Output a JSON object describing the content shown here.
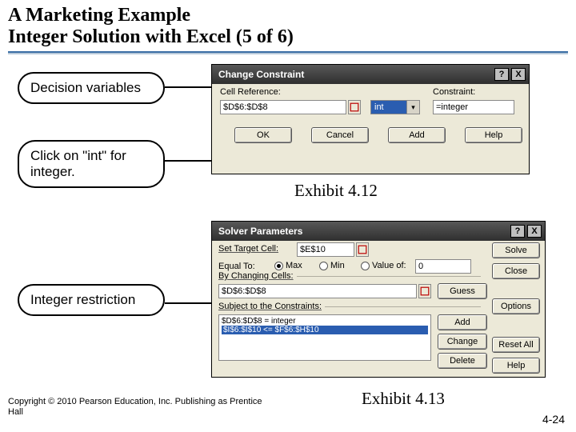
{
  "title": {
    "line1": "A Marketing Example",
    "line2": "Integer Solution with Excel (5 of 6)"
  },
  "bubbles": {
    "decision_vars": "Decision variables",
    "click_int": "Click on \"int\" for integer.",
    "int_restriction": "Integer restriction"
  },
  "dialog1": {
    "title": "Change Constraint",
    "cell_ref_label": "Cell Reference:",
    "cell_ref_value": "$D$6:$D$8",
    "op_value": "int",
    "constraint_label": "Constraint:",
    "constraint_value": "=integer",
    "buttons": {
      "ok": "OK",
      "cancel": "Cancel",
      "add": "Add",
      "help": "Help"
    }
  },
  "dialog2": {
    "title": "Solver Parameters",
    "set_target_label": "Set Target Cell:",
    "set_target_value": "$E$10",
    "equal_to_label": "Equal To:",
    "radios": {
      "max": "Max",
      "min": "Min",
      "value_of": "Value of:"
    },
    "value_of_value": "0",
    "by_changing_label": "By Changing Cells:",
    "by_changing_value": "$D$6:$D$8",
    "subject_label": "Subject to the Constraints:",
    "constraints": [
      "$D$6:$D$8 = integer",
      "$I$6:$I$10 <= $F$6:$H$10"
    ],
    "buttons": {
      "solve": "Solve",
      "close": "Close",
      "guess": "Guess",
      "options": "Options",
      "add": "Add",
      "change": "Change",
      "delete": "Delete",
      "reset": "Reset All",
      "help": "Help"
    }
  },
  "exhibits": {
    "e412": "Exhibit 4.12",
    "e413": "Exhibit 4.13"
  },
  "footer": {
    "copyright": "Copyright © 2010 Pearson Education, Inc. Publishing as Prentice Hall",
    "pagenum": "4-24"
  },
  "icons": {
    "help": "?",
    "close": "X",
    "dropdown": "▾"
  }
}
